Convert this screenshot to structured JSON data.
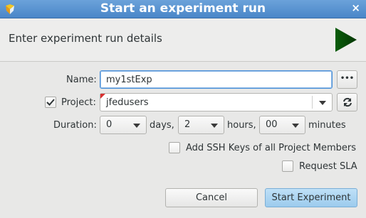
{
  "window": {
    "title": "Start an experiment run",
    "close_glyph": "×",
    "app_icon": "app-logo-icon",
    "close_icon": "close-icon"
  },
  "header": {
    "text": "Enter experiment run details",
    "icon": "play-icon",
    "icon_color": "#0b4d0b"
  },
  "form": {
    "name_label": "Name:",
    "name_value": "my1stExp",
    "browse_label": "•••",
    "project_label": "Project:",
    "project_checked": true,
    "project_value": "jfedusers",
    "refresh_icon": "refresh-icon",
    "duration_label": "Duration:",
    "days_value": "0",
    "days_label": "days,",
    "hours_value": "2",
    "hours_label": "hours,",
    "minutes_value": "00",
    "minutes_label": "minutes",
    "ssh_label": "Add SSH Keys of all Project Members",
    "ssh_checked": false,
    "sla_label": "Request SLA",
    "sla_checked": false
  },
  "buttons": {
    "cancel": "Cancel",
    "start": "Start Experiment"
  },
  "colors": {
    "title_bar": "#4a86c8",
    "focus": "#4a90d9",
    "primary_button": "#a9d2f0"
  }
}
